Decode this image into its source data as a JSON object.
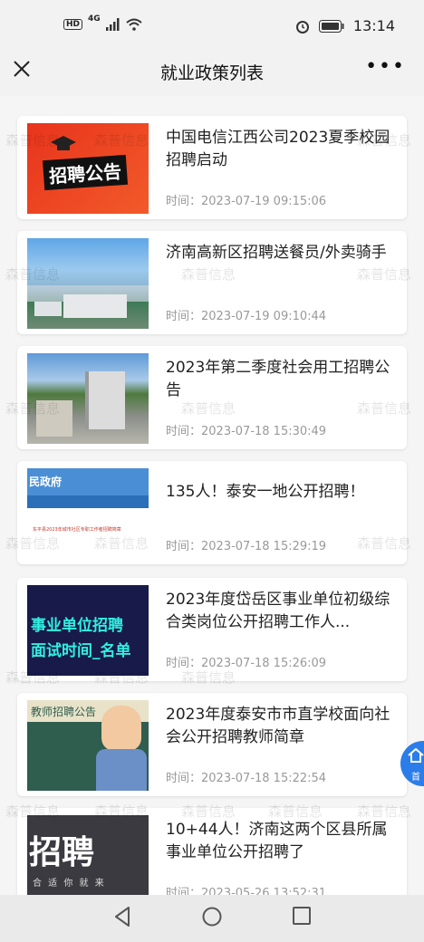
{
  "status": {
    "hd": "HD",
    "network": "4G",
    "time": "13:14"
  },
  "nav": {
    "title": "就业政策列表",
    "more": "•••"
  },
  "watermark": "森普信息",
  "items": [
    {
      "title": "中国电信江西公司2023夏季校园招聘启动",
      "time": "时间：2023-07-19 09:15:06",
      "thumb_text": "招聘公告"
    },
    {
      "title": "济南高新区招聘送餐员/外卖骑手",
      "time": "时间：2023-07-19 09:10:44"
    },
    {
      "title": "2023年第二季度社会用工招聘公告",
      "time": "时间：2023-07-18 15:30:49"
    },
    {
      "title": "135人！泰安一地公开招聘！",
      "time": "时间：2023-07-18 15:29:19",
      "thumb_text": "民政府",
      "thumb_text2": "东平县2023年城市社区专职工作者招聘简章"
    },
    {
      "title": "2023年度岱岳区事业单位初级综合类岗位公开招聘工作人...",
      "time": "时间：2023-07-18 15:26:09",
      "thumb_text": "事业单位招聘",
      "thumb_text2": "面试时间_名单"
    },
    {
      "title": "2023年度泰安市市直学校面向社会公开招聘教师简章",
      "time": "时间：2023-07-18 15:22:54",
      "thumb_text": "教师招聘公告"
    },
    {
      "title": "10+44人！济南这两个区县所属事业单位公开招聘了",
      "time": "时间：2023-05-26 13:52:31",
      "thumb_text": "招聘",
      "thumb_text2": "合 适 你 就 来"
    }
  ],
  "floating": {
    "home_label": "首"
  }
}
